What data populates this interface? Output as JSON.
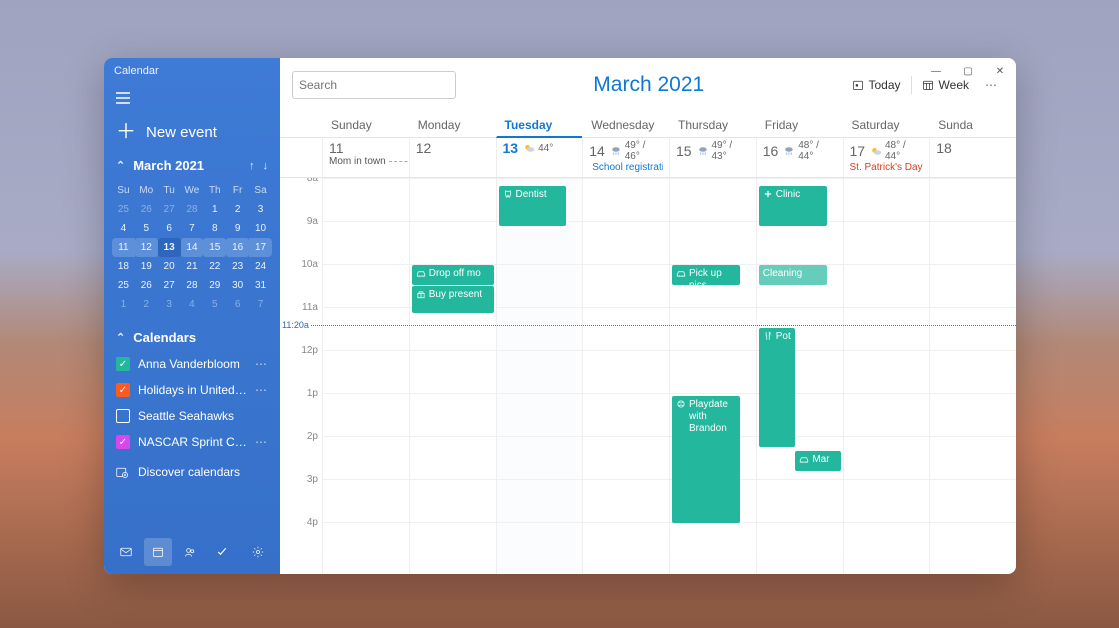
{
  "app_title": "Calendar",
  "new_event_label": "New event",
  "month_label": "March 2021",
  "mini_cal": {
    "dow": [
      "Su",
      "Mo",
      "Tu",
      "We",
      "Th",
      "Fr",
      "Sa"
    ],
    "rows": [
      {
        "hl": false,
        "cells": [
          {
            "v": "25",
            "dim": true
          },
          {
            "v": "26",
            "dim": true
          },
          {
            "v": "27",
            "dim": true
          },
          {
            "v": "28",
            "dim": true
          },
          {
            "v": "1"
          },
          {
            "v": "2"
          },
          {
            "v": "3"
          }
        ]
      },
      {
        "hl": false,
        "cells": [
          {
            "v": "4"
          },
          {
            "v": "5"
          },
          {
            "v": "6"
          },
          {
            "v": "7"
          },
          {
            "v": "8"
          },
          {
            "v": "9"
          },
          {
            "v": "10"
          }
        ]
      },
      {
        "hl": true,
        "cells": [
          {
            "v": "11"
          },
          {
            "v": "12"
          },
          {
            "v": "13",
            "today": true
          },
          {
            "v": "14"
          },
          {
            "v": "15"
          },
          {
            "v": "16"
          },
          {
            "v": "17"
          }
        ]
      },
      {
        "hl": false,
        "cells": [
          {
            "v": "18"
          },
          {
            "v": "19"
          },
          {
            "v": "20"
          },
          {
            "v": "21"
          },
          {
            "v": "22"
          },
          {
            "v": "23"
          },
          {
            "v": "24"
          }
        ]
      },
      {
        "hl": false,
        "cells": [
          {
            "v": "25"
          },
          {
            "v": "26"
          },
          {
            "v": "27"
          },
          {
            "v": "28"
          },
          {
            "v": "29"
          },
          {
            "v": "30"
          },
          {
            "v": "31"
          }
        ]
      },
      {
        "hl": false,
        "cells": [
          {
            "v": "1",
            "dim": true
          },
          {
            "v": "2",
            "dim": true
          },
          {
            "v": "3",
            "dim": true
          },
          {
            "v": "4",
            "dim": true
          },
          {
            "v": "5",
            "dim": true
          },
          {
            "v": "6",
            "dim": true
          },
          {
            "v": "7",
            "dim": true
          }
        ]
      }
    ]
  },
  "calendars_label": "Calendars",
  "calendars": [
    {
      "label": "Anna Vanderbloom",
      "color": "#23b89d",
      "checked": true,
      "more": true
    },
    {
      "label": "Holidays in United States",
      "color": "#ff5a1f",
      "checked": true,
      "more": true
    },
    {
      "label": "Seattle Seahawks",
      "color": "#ffffff",
      "checked": false,
      "more": false
    },
    {
      "label": "NASCAR Sprint Cup",
      "color": "#d946ef",
      "checked": true,
      "more": true
    }
  ],
  "discover_label": "Discover calendars",
  "search_placeholder": "Search",
  "main_title": "March 2021",
  "toolbar": {
    "today": "Today",
    "week": "Week"
  },
  "day_headers": [
    "Sunday",
    "Monday",
    "Tuesday",
    "Wednesday",
    "Thursday",
    "Friday",
    "Saturday",
    "Sunda"
  ],
  "selected_day_index": 2,
  "dates": [
    {
      "num": "11",
      "allday": {
        "text": "Mom in town",
        "dashed": true
      }
    },
    {
      "num": "12"
    },
    {
      "num": "13",
      "selected": true,
      "weather": {
        "icon": "partly",
        "temp": "44°"
      }
    },
    {
      "num": "14",
      "weather": {
        "icon": "rain",
        "temp": "49° / 46°"
      },
      "allday": {
        "text": "School registrati",
        "link": true,
        "icon": "globe"
      }
    },
    {
      "num": "15",
      "weather": {
        "icon": "rain",
        "temp": "49° / 43°"
      }
    },
    {
      "num": "16",
      "weather": {
        "icon": "showers",
        "temp": "48° / 44°"
      }
    },
    {
      "num": "17",
      "weather": {
        "icon": "partly",
        "temp": "48° / 44°"
      },
      "allday": {
        "text": "St. Patrick's Day",
        "holiday": true
      }
    },
    {
      "num": "18"
    }
  ],
  "hours": [
    "8a",
    "9a",
    "10a",
    "11a",
    "12p",
    "1p",
    "2p",
    "3p",
    "4p"
  ],
  "now": {
    "label": "11:20a",
    "offset_pct": 37
  },
  "events": [
    {
      "col": 2,
      "label": "Dentist",
      "icon": "tooth",
      "start_pct": 2,
      "height_pct": 10,
      "right_gap": true
    },
    {
      "col": 1,
      "label": "Drop off mo",
      "icon": "car",
      "start_pct": 22,
      "height_pct": 5
    },
    {
      "col": 1,
      "label": "Buy present",
      "icon": "gift",
      "start_pct": 27.2,
      "height_pct": 7
    },
    {
      "col": 4,
      "label": "Pick up pics",
      "icon": "car",
      "start_pct": 22,
      "height_pct": 5,
      "right_gap": true
    },
    {
      "col": 5,
      "label": "Clinic",
      "icon": "plus",
      "start_pct": 2,
      "height_pct": 10,
      "right_gap": true
    },
    {
      "col": 5,
      "label": "Cleaning",
      "start_pct": 22,
      "height_pct": 5,
      "light": true,
      "right_gap": true
    },
    {
      "col": 5,
      "label": "Potl",
      "icon": "fork",
      "start_pct": 38,
      "height_pct": 30,
      "narrow": true
    },
    {
      "col": 5,
      "label": "Mar",
      "icon": "car",
      "start_pct": 69,
      "height_pct": 5,
      "narrow_right": true
    },
    {
      "col": 4,
      "label": "Playdate with Brandon",
      "icon": "ball",
      "start_pct": 55,
      "height_pct": 32,
      "right_gap": true
    }
  ]
}
